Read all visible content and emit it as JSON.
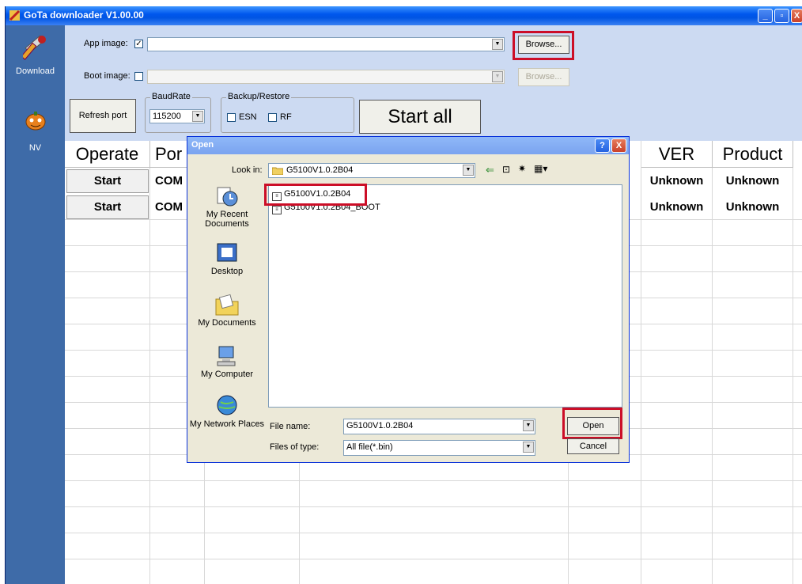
{
  "window": {
    "title": "GoTa downloader V1.00.00",
    "min": "_",
    "restore": "▫",
    "close": "X"
  },
  "sidebar": {
    "items": [
      {
        "label": "Download",
        "icon": "tools-icon"
      },
      {
        "label": "NV",
        "icon": "pumpkin-icon"
      }
    ]
  },
  "controls": {
    "app_image_label": "App image:",
    "app_image_checked": "✓",
    "app_image_value": "",
    "boot_image_label": "Boot image:",
    "boot_image_value": "",
    "browse_label": "Browse...",
    "browse_disabled_label": "Browse...",
    "refresh_label": "Refresh port",
    "baudrate_group": "BaudRate",
    "baudrate_value": "115200",
    "backup_group": "Backup/Restore",
    "esn_label": "ESN",
    "rf_label": "RF",
    "start_all_label": "Start all"
  },
  "table": {
    "headers": [
      "Operate",
      "Por",
      "VER",
      "Product"
    ],
    "rows": [
      {
        "operate": "Start",
        "port": "COM",
        "ver": "Unknown",
        "product": "Unknown"
      },
      {
        "operate": "Start",
        "port": "COM",
        "ver": "Unknown",
        "product": "Unknown"
      }
    ]
  },
  "dialog": {
    "title": "Open",
    "help": "?",
    "close": "X",
    "look_in_label": "Look in:",
    "look_in_value": "G5100V1.0.2B04",
    "places": [
      "My Recent Documents",
      "Desktop",
      "My Documents",
      "My Computer",
      "My Network Places"
    ],
    "files": [
      "G5100V1.0.2B04",
      "G5100V1.0.2B04_BOOT"
    ],
    "file_name_label": "File name:",
    "file_name_value": "G5100V1.0.2B04",
    "file_type_label": "Files of type:",
    "file_type_value": "All file(*.bin)",
    "open_label": "Open",
    "cancel_label": "Cancel"
  }
}
